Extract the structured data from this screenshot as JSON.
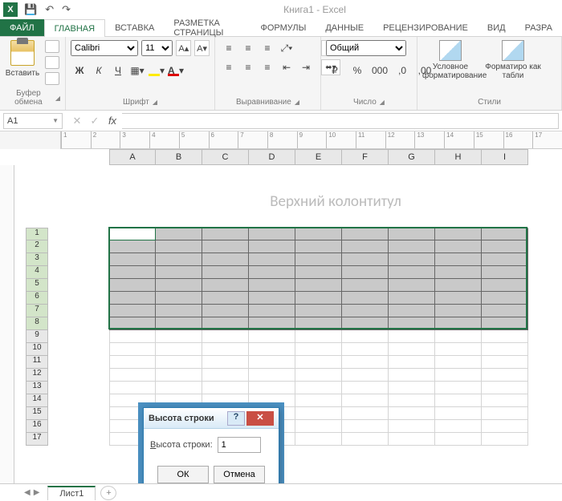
{
  "app": {
    "title": "Книга1 - Excel",
    "icon_text": "X"
  },
  "qat": {
    "save": "💾",
    "undo": "↶",
    "redo": "↷"
  },
  "tabs": {
    "file": "ФАЙЛ",
    "items": [
      "ГЛАВНАЯ",
      "ВСТАВКА",
      "РАЗМЕТКА СТРАНИЦЫ",
      "ФОРМУЛЫ",
      "ДАННЫЕ",
      "РЕЦЕНЗИРОВАНИЕ",
      "ВИД",
      "РАЗРА"
    ]
  },
  "ribbon": {
    "clipboard": {
      "paste": "Вставить",
      "label": "Буфер обмена"
    },
    "font": {
      "name": "Calibri",
      "size": "11",
      "bold": "Ж",
      "italic": "К",
      "underline": "Ч",
      "label": "Шрифт"
    },
    "align": {
      "label": "Выравнивание"
    },
    "number": {
      "format": "Общий",
      "label": "Число",
      "currency": "₽",
      "percent": "%",
      "comma": "000",
      "inc": ",0",
      "dec": ",00"
    },
    "styles": {
      "cond": "Условное форматирование",
      "table": "Форматиро как табли",
      "label": "Стили"
    }
  },
  "formula_bar": {
    "name_box": "A1",
    "cancel": "✕",
    "enter": "✓",
    "fx": "fx"
  },
  "ruler_marks": [
    "1",
    "2",
    "3",
    "4",
    "5",
    "6",
    "7",
    "8",
    "9",
    "10",
    "11",
    "12",
    "13",
    "14",
    "15",
    "16",
    "17"
  ],
  "columns": [
    "A",
    "B",
    "C",
    "D",
    "E",
    "F",
    "G",
    "H",
    "I"
  ],
  "header_text": "Верхний колонтитул",
  "rows_labels": [
    "1",
    "2",
    "3",
    "4",
    "5",
    "6",
    "7",
    "8",
    "9",
    "10",
    "11",
    "12",
    "13",
    "14",
    "15",
    "16",
    "17"
  ],
  "selected_rows": 8,
  "dialog": {
    "title": "Высота строки",
    "label": "Высота строки:",
    "value": "1",
    "ok": "ОК",
    "cancel": "Отмена",
    "help": "?",
    "close": "✕"
  },
  "sheet_tabs": {
    "active": "Лист1",
    "add": "+"
  }
}
